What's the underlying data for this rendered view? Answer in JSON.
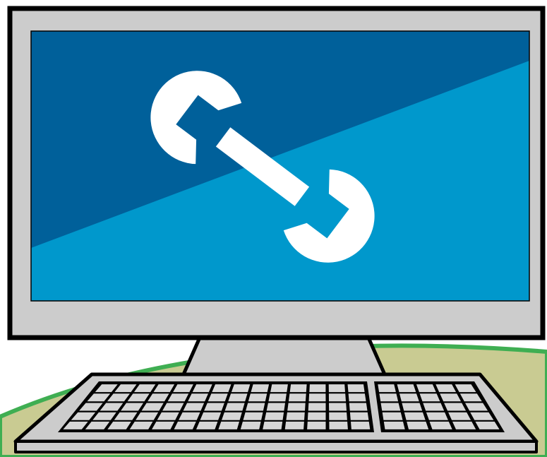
{
  "illustration": {
    "subject": "computer-maintenance",
    "icons": [
      "monitor-icon",
      "wrench-icon",
      "keyboard-icon"
    ],
    "colors": {
      "background": "#ffffff",
      "ground_fill": "#c9cb92",
      "ground_edge": "#3fae52",
      "bezel": "#cccccc",
      "outline": "#000000",
      "screen_dark": "#00609a",
      "screen_light": "#0098cc",
      "wrench": "#ffffff",
      "stand": "#cccccc",
      "keyboard_body": "#cccccc",
      "key": "#d6d6d6"
    },
    "keyboard": {
      "main_key_rows": 5,
      "main_key_columns": 14,
      "numpad_rows": 5,
      "numpad_columns": 5
    }
  }
}
